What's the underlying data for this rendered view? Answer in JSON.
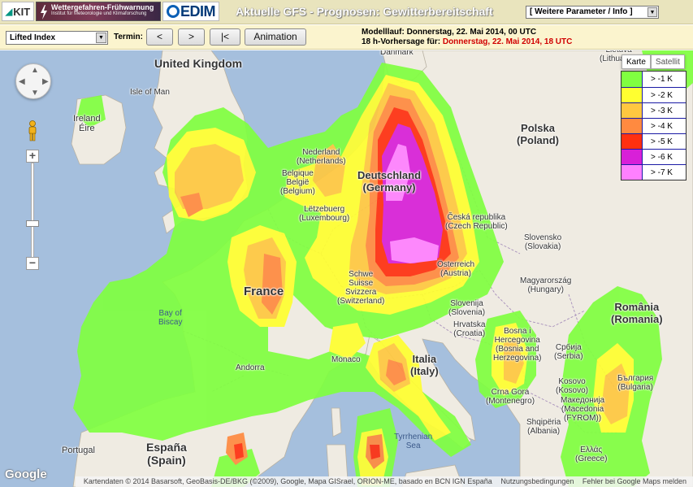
{
  "header": {
    "logo_kit": "KIT",
    "logo_warn_title": "Wettergefahren-Frühwarnung",
    "logo_warn_sub": "Institut für Meteorologie und Klimaforschung",
    "logo_cedim": "EDIM",
    "title": "Aktuelle GFS - Prognosen: Gewitterbereitschaft",
    "param_select": "[ Weitere Parameter / Info ]"
  },
  "toolbar": {
    "variable": "Lifted Index",
    "termin_label": "Termin:",
    "prev_label": "<",
    "next_label": ">",
    "first_label": "|<",
    "anim_label": "Animation",
    "model_run_label": "Modelllauf:",
    "model_run_value": "Donnerstag, 22. Mai 2014, 00 UTC",
    "forecast_label": "18 h-Vorhersage für:",
    "forecast_value": "Donnerstag, 22. Mai 2014, 18 UTC"
  },
  "maptype": {
    "karte": "Karte",
    "satellit": "Satellit"
  },
  "legend": [
    {
      "label": "> -1 K",
      "color": "#80ff40"
    },
    {
      "label": "> -2 K",
      "color": "#ffff30"
    },
    {
      "label": "> -3 K",
      "color": "#ffc840"
    },
    {
      "label": "> -4 K",
      "color": "#ff8a40"
    },
    {
      "label": "> -5 K",
      "color": "#ff3010"
    },
    {
      "label": "> -6 K",
      "color": "#d820d8"
    },
    {
      "label": "> -7 K",
      "color": "#ff80ff"
    }
  ],
  "labels": {
    "uk": "United Kingdom",
    "isle_of_man": "Isle of Man",
    "ireland": "Ireland\nÉire",
    "nederland": "Nederland\n(Netherlands)",
    "belgique": "Belgique\nBelgië\n(Belgium)",
    "deutschland": "Deutschland\n(Germany)",
    "letzebuerg": "Lëtzebuerg\n(Luxembourg)",
    "france": "France",
    "bay_of_biscay": "Bay of\nBiscay",
    "schweiz": "Schwe\nSuisse\nSvizzera\n(Switzerland)",
    "monaco": "Monaco",
    "andorra": "Andorra",
    "portugal": "Portugal",
    "espana": "España\n(Spain)",
    "italia": "Italia\n(Italy)",
    "tyrrhenian": "Tyrrhenian\nSea",
    "polska": "Polska\n(Poland)",
    "cesko": "Česká republika\n(Czech Republic)",
    "osterreich": "Österreich\n(Austria)",
    "slovensko": "Slovensko\n(Slovakia)",
    "magyar": "Magyarország\n(Hungary)",
    "slovenija": "Slovenija\n(Slovenia)",
    "hrvatska": "Hrvatska\n(Croatia)",
    "bosna": "Bosna i\nHercegovina\n(Bosnia and\nHerzegovina)",
    "srbija": "Србија\n(Serbia)",
    "romania": "România\n(Romania)",
    "crna_gora": "Crna Gora\n(Montenegro)",
    "kosovo": "Kosovo\n(Kosovo)",
    "bulgaria": "България\n(Bulgaria)",
    "macedonia": "Македонија\n(Macedonia\n(FYROM))",
    "shqiperia": "Shqipëria\n(Albania)",
    "ellas": "Ελλάς\n(Greece)",
    "lietuva": "Lietuva\n(Lithuania)",
    "danmark": "Danmark"
  },
  "footer": {
    "google": "Google",
    "attribution": "Kartendaten © 2014 Basarsoft, GeoBasis-DE/BKG (©2009), Google, Mapa GISrael, ORION-ME, basado en BCN IGN España",
    "terms": "Nutzungsbedingungen",
    "report": "Fehler bei Google Maps melden"
  }
}
